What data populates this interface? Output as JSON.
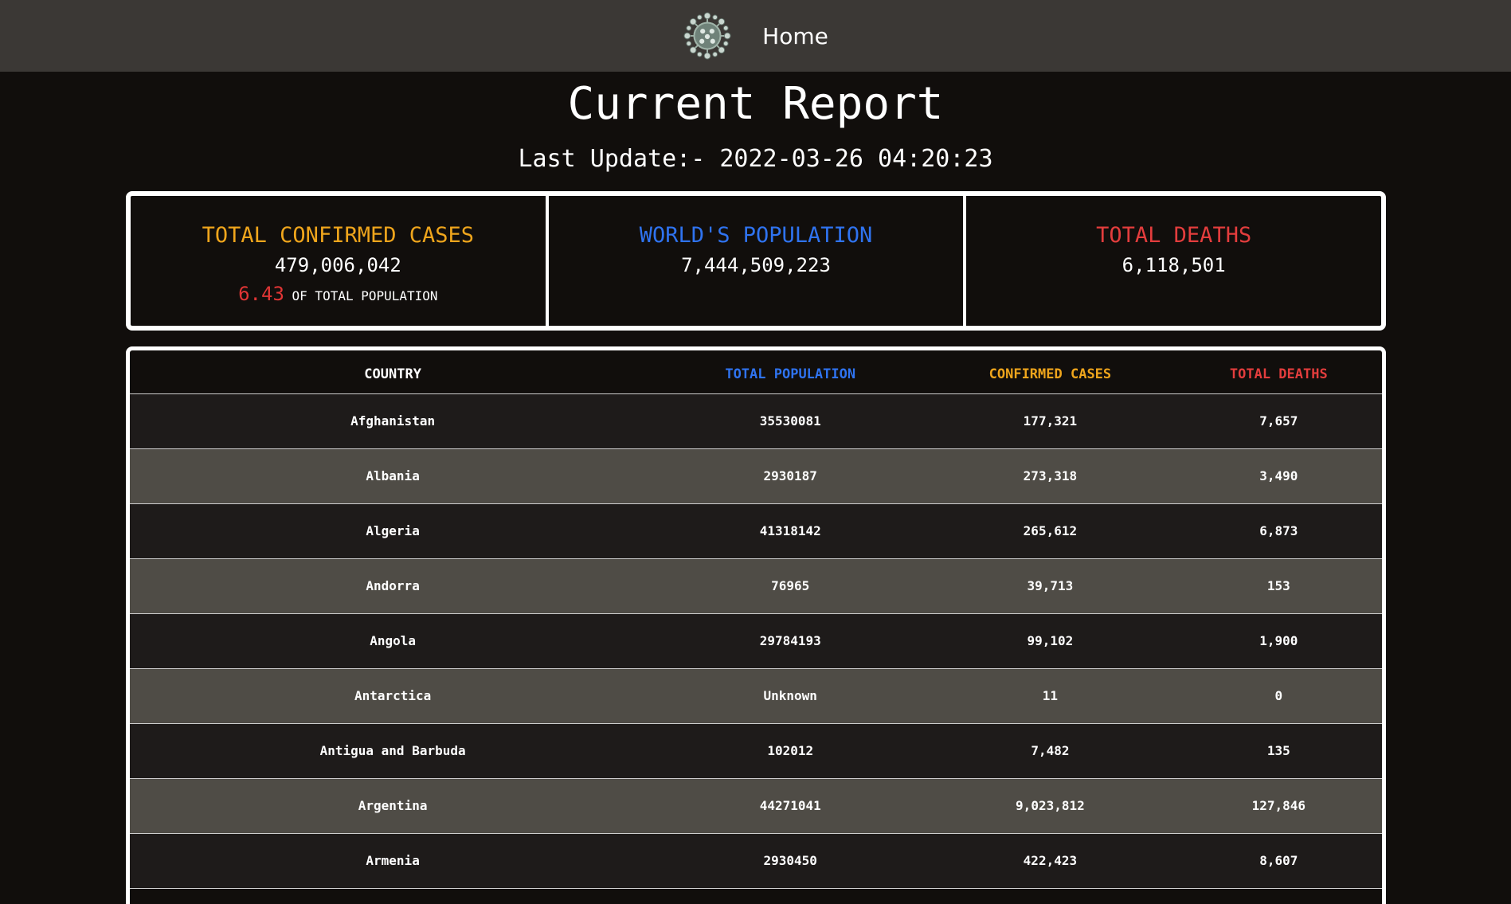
{
  "nav": {
    "logo_icon": "virus-icon",
    "home_label": "Home"
  },
  "page": {
    "title": "Current Report",
    "last_update": "Last Update:- 2022-03-26 04:20:23"
  },
  "stats": {
    "confirmed": {
      "label": "TOTAL CONFIRMED CASES",
      "value": "479,006,042",
      "percent": "6.43",
      "percent_suffix": "OF TOTAL POPULATION"
    },
    "population": {
      "label": "WORLD'S POPULATION",
      "value": "7,444,509,223"
    },
    "deaths": {
      "label": "TOTAL DEATHS",
      "value": "6,118,501"
    }
  },
  "table": {
    "headers": {
      "country": "COUNTRY",
      "population": "TOTAL POPULATION",
      "cases": "CONFIRMED CASES",
      "deaths": "TOTAL DEATHS"
    },
    "rows": [
      {
        "country": "Afghanistan",
        "population": "35530081",
        "cases": "177,321",
        "deaths": "7,657"
      },
      {
        "country": "Albania",
        "population": "2930187",
        "cases": "273,318",
        "deaths": "3,490"
      },
      {
        "country": "Algeria",
        "population": "41318142",
        "cases": "265,612",
        "deaths": "6,873"
      },
      {
        "country": "Andorra",
        "population": "76965",
        "cases": "39,713",
        "deaths": "153"
      },
      {
        "country": "Angola",
        "population": "29784193",
        "cases": "99,102",
        "deaths": "1,900"
      },
      {
        "country": "Antarctica",
        "population": "Unknown",
        "cases": "11",
        "deaths": "0"
      },
      {
        "country": "Antigua and Barbuda",
        "population": "102012",
        "cases": "7,482",
        "deaths": "135"
      },
      {
        "country": "Argentina",
        "population": "44271041",
        "cases": "9,023,812",
        "deaths": "127,846"
      },
      {
        "country": "Armenia",
        "population": "2930450",
        "cases": "422,423",
        "deaths": "8,607"
      }
    ]
  },
  "colors": {
    "background": "#110e0c",
    "navbar": "#3b3835",
    "orange": "#efa51c",
    "blue": "#2f73f0",
    "red": "#e33d3d",
    "row_dark": "#1e1b1a",
    "row_light": "#4f4c46"
  }
}
